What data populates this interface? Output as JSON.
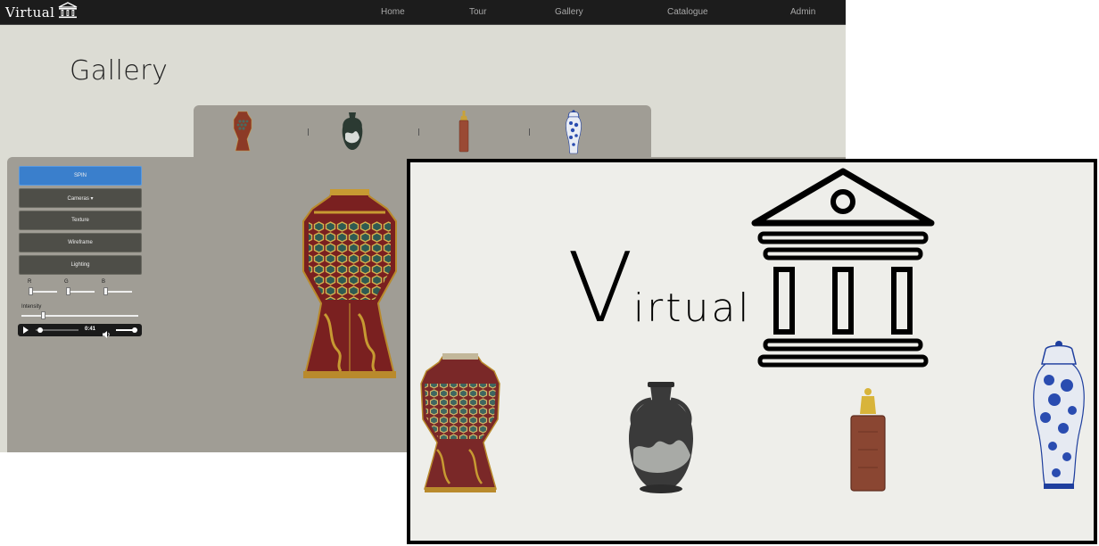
{
  "app": {
    "brand": "Virtual"
  },
  "nav": {
    "items": [
      "Home",
      "Tour",
      "Gallery",
      "Catalogue",
      "Admin"
    ]
  },
  "page": {
    "title": "Gallery"
  },
  "thumbnails": [
    "vase-hexagonal-red-gold",
    "vase-portland-dark",
    "vase-square-brown",
    "vase-blue-white-jar"
  ],
  "controls": {
    "buttons": [
      "SPIN",
      "Cameras ▾",
      "Texture",
      "Wireframe",
      "Lighting"
    ],
    "sliders": {
      "r_label": "R",
      "g_label": "G",
      "b_label": "B",
      "intensity_label": "Intensity",
      "r_value": 0.0,
      "g_value": 0.0,
      "b_value": 0.0,
      "intensity_value": 0.18
    }
  },
  "audio": {
    "time": "0:41",
    "progress": 0.05,
    "volume": 0.85
  },
  "card": {
    "logo_text_big": "V",
    "logo_text_rest": "irtual",
    "vases": [
      "vase-hexagonal-red-gold",
      "vase-portland-dark",
      "vase-square-brown",
      "vase-blue-white-jar"
    ]
  },
  "colors": {
    "navbar": "#1c1c1c",
    "primary_button": "#3a7fcc",
    "panel": "#a09d95",
    "page_bg": "#dcdcd4"
  }
}
